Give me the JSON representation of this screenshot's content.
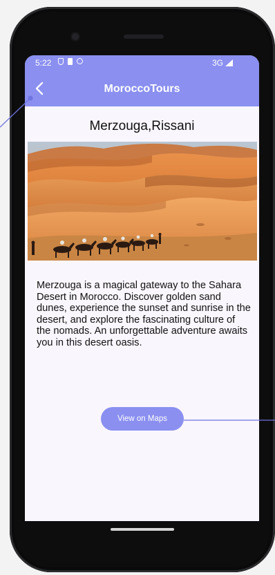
{
  "status_bar": {
    "time": "5:22",
    "network": "3G",
    "icons": [
      "vpn-icon",
      "sd-card-icon",
      "sync-icon",
      "signal-icon"
    ]
  },
  "app_bar": {
    "title": "MoroccoTours",
    "back_icon": "chevron-left-icon"
  },
  "place": {
    "title": "Merzouga,Rissani",
    "image": "desert-dunes-camel-caravan",
    "description": "Merzouga is a magical gateway to the Sahara Desert in Morocco. Discover golden sand dunes, experience the sunset and sunrise in the desert, and explore the fascinating culture of the nomads. An unforgettable adventure awaits you in this desert oasis."
  },
  "actions": {
    "maps_button": "View on Maps"
  },
  "colors": {
    "accent": "#8a8ff0",
    "screen_bg": "#faf6fd",
    "phone_frame": "#0d0d0e"
  }
}
